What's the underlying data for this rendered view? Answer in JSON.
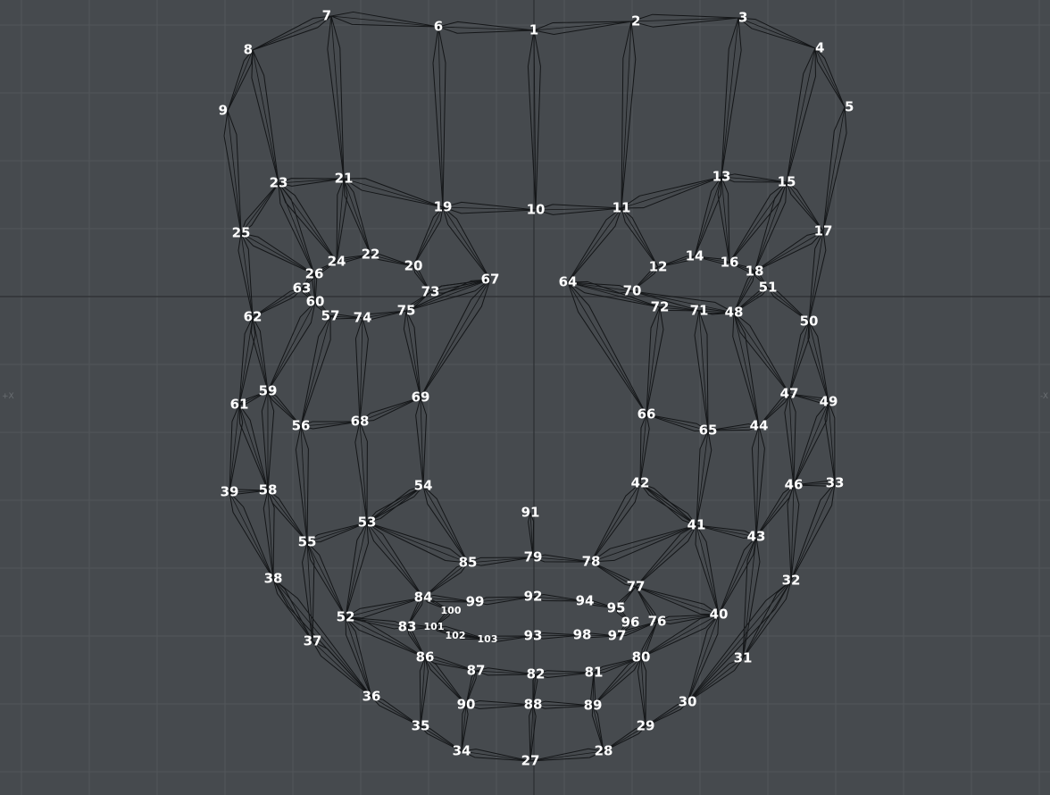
{
  "colors": {
    "background": "#464a4e",
    "grid": "#52565a",
    "axis": "#2c2f32",
    "wire": "#141618",
    "label": "#ffffff"
  },
  "viewport_edge_markers": [
    "+X",
    "-X"
  ],
  "mesh": {
    "vertices": [
      {
        "id": "1",
        "label": "1"
      },
      {
        "id": "2",
        "label": "2"
      },
      {
        "id": "3",
        "label": "3"
      },
      {
        "id": "4",
        "label": "4"
      },
      {
        "id": "5",
        "label": "5"
      },
      {
        "id": "6",
        "label": "6"
      },
      {
        "id": "7",
        "label": "7"
      },
      {
        "id": "8",
        "label": "8"
      },
      {
        "id": "9",
        "label": "9"
      },
      {
        "id": "10",
        "label": "10"
      },
      {
        "id": "11",
        "label": "11"
      },
      {
        "id": "12",
        "label": "12"
      },
      {
        "id": "13",
        "label": "13"
      },
      {
        "id": "14",
        "label": "14"
      },
      {
        "id": "15",
        "label": "15"
      },
      {
        "id": "16",
        "label": "16"
      },
      {
        "id": "17",
        "label": "17"
      },
      {
        "id": "18",
        "label": "18"
      },
      {
        "id": "19",
        "label": "19"
      },
      {
        "id": "20",
        "label": "20"
      },
      {
        "id": "21",
        "label": "21"
      },
      {
        "id": "22",
        "label": "22"
      },
      {
        "id": "23",
        "label": "23"
      },
      {
        "id": "24",
        "label": "24"
      },
      {
        "id": "25",
        "label": "25"
      },
      {
        "id": "26",
        "label": "26"
      },
      {
        "id": "27",
        "label": "27"
      },
      {
        "id": "28",
        "label": "28"
      },
      {
        "id": "29",
        "label": "29"
      },
      {
        "id": "30",
        "label": "30"
      },
      {
        "id": "31",
        "label": "31"
      },
      {
        "id": "32",
        "label": "32"
      },
      {
        "id": "33",
        "label": "33"
      },
      {
        "id": "34",
        "label": "34"
      },
      {
        "id": "35",
        "label": "35"
      },
      {
        "id": "36",
        "label": "36"
      },
      {
        "id": "37",
        "label": "37"
      },
      {
        "id": "38",
        "label": "38"
      },
      {
        "id": "39",
        "label": "39"
      },
      {
        "id": "40",
        "label": "40"
      },
      {
        "id": "41",
        "label": "41"
      },
      {
        "id": "42",
        "label": "42"
      },
      {
        "id": "43",
        "label": "43"
      },
      {
        "id": "44",
        "label": "44"
      },
      {
        "id": "46",
        "label": "46"
      },
      {
        "id": "47",
        "label": "47"
      },
      {
        "id": "48",
        "label": "48"
      },
      {
        "id": "49",
        "label": "49"
      },
      {
        "id": "50",
        "label": "50"
      },
      {
        "id": "51",
        "label": "51"
      },
      {
        "id": "52",
        "label": "52"
      },
      {
        "id": "53",
        "label": "53"
      },
      {
        "id": "54",
        "label": "54"
      },
      {
        "id": "55",
        "label": "55"
      },
      {
        "id": "56",
        "label": "56"
      },
      {
        "id": "57",
        "label": "57"
      },
      {
        "id": "58",
        "label": "58"
      },
      {
        "id": "59",
        "label": "59"
      },
      {
        "id": "60",
        "label": "60"
      },
      {
        "id": "61",
        "label": "61"
      },
      {
        "id": "62",
        "label": "62"
      },
      {
        "id": "63",
        "label": "63"
      },
      {
        "id": "64",
        "label": "64"
      },
      {
        "id": "65",
        "label": "65"
      },
      {
        "id": "66",
        "label": "66"
      },
      {
        "id": "67",
        "label": "67"
      },
      {
        "id": "68",
        "label": "68"
      },
      {
        "id": "69",
        "label": "69"
      },
      {
        "id": "70",
        "label": "70"
      },
      {
        "id": "71",
        "label": "71"
      },
      {
        "id": "72",
        "label": "72"
      },
      {
        "id": "73",
        "label": "73"
      },
      {
        "id": "74",
        "label": "74"
      },
      {
        "id": "75",
        "label": "75"
      },
      {
        "id": "76",
        "label": "76"
      },
      {
        "id": "77",
        "label": "77"
      },
      {
        "id": "78",
        "label": "78"
      },
      {
        "id": "79",
        "label": "79"
      },
      {
        "id": "80",
        "label": "80"
      },
      {
        "id": "81",
        "label": "81"
      },
      {
        "id": "82",
        "label": "82"
      },
      {
        "id": "83",
        "label": "83"
      },
      {
        "id": "84",
        "label": "84"
      },
      {
        "id": "85",
        "label": "85"
      },
      {
        "id": "86",
        "label": "86"
      },
      {
        "id": "87",
        "label": "87"
      },
      {
        "id": "88",
        "label": "88"
      },
      {
        "id": "89",
        "label": "89"
      },
      {
        "id": "90",
        "label": "90"
      },
      {
        "id": "91",
        "label": "91"
      },
      {
        "id": "92",
        "label": "92"
      },
      {
        "id": "93",
        "label": "93"
      },
      {
        "id": "94",
        "label": "94"
      },
      {
        "id": "95",
        "label": "95"
      },
      {
        "id": "96",
        "label": "96"
      },
      {
        "id": "97",
        "label": "97"
      },
      {
        "id": "98",
        "label": "98"
      },
      {
        "id": "99",
        "label": "99"
      },
      {
        "id": "100",
        "label": "100"
      },
      {
        "id": "101",
        "label": "101"
      },
      {
        "id": "102",
        "label": "102"
      },
      {
        "id": "103",
        "label": "103"
      }
    ],
    "edges": [
      [
        "7",
        "6"
      ],
      [
        "6",
        "1"
      ],
      [
        "1",
        "2"
      ],
      [
        "2",
        "3"
      ],
      [
        "7",
        "8"
      ],
      [
        "8",
        "9"
      ],
      [
        "3",
        "4"
      ],
      [
        "4",
        "5"
      ],
      [
        "1",
        "10"
      ],
      [
        "6",
        "19"
      ],
      [
        "2",
        "11"
      ],
      [
        "7",
        "21"
      ],
      [
        "3",
        "13"
      ],
      [
        "8",
        "23"
      ],
      [
        "4",
        "15"
      ],
      [
        "9",
        "25"
      ],
      [
        "5",
        "17"
      ],
      [
        "25",
        "23"
      ],
      [
        "23",
        "21"
      ],
      [
        "21",
        "19"
      ],
      [
        "19",
        "10"
      ],
      [
        "10",
        "11"
      ],
      [
        "11",
        "13"
      ],
      [
        "13",
        "15"
      ],
      [
        "15",
        "17"
      ],
      [
        "25",
        "26"
      ],
      [
        "23",
        "26"
      ],
      [
        "23",
        "24"
      ],
      [
        "21",
        "24"
      ],
      [
        "21",
        "22"
      ],
      [
        "19",
        "20"
      ],
      [
        "19",
        "67"
      ],
      [
        "26",
        "24"
      ],
      [
        "24",
        "22"
      ],
      [
        "22",
        "20"
      ],
      [
        "20",
        "73"
      ],
      [
        "73",
        "67"
      ],
      [
        "17",
        "18"
      ],
      [
        "15",
        "18"
      ],
      [
        "15",
        "16"
      ],
      [
        "13",
        "16"
      ],
      [
        "13",
        "14"
      ],
      [
        "11",
        "12"
      ],
      [
        "11",
        "64"
      ],
      [
        "18",
        "16"
      ],
      [
        "16",
        "14"
      ],
      [
        "14",
        "12"
      ],
      [
        "12",
        "70"
      ],
      [
        "70",
        "64"
      ],
      [
        "25",
        "62"
      ],
      [
        "26",
        "63"
      ],
      [
        "63",
        "60"
      ],
      [
        "63",
        "62"
      ],
      [
        "26",
        "60"
      ],
      [
        "17",
        "50"
      ],
      [
        "18",
        "51"
      ],
      [
        "51",
        "48"
      ],
      [
        "51",
        "50"
      ],
      [
        "18",
        "48"
      ],
      [
        "60",
        "57"
      ],
      [
        "57",
        "74"
      ],
      [
        "74",
        "75"
      ],
      [
        "75",
        "73"
      ],
      [
        "73",
        "67"
      ],
      [
        "67",
        "75"
      ],
      [
        "64",
        "72"
      ],
      [
        "72",
        "71"
      ],
      [
        "71",
        "48"
      ],
      [
        "48",
        "70"
      ],
      [
        "62",
        "61"
      ],
      [
        "62",
        "59"
      ],
      [
        "60",
        "59"
      ],
      [
        "57",
        "56"
      ],
      [
        "74",
        "68"
      ],
      [
        "75",
        "69"
      ],
      [
        "67",
        "69"
      ],
      [
        "50",
        "49"
      ],
      [
        "50",
        "47"
      ],
      [
        "48",
        "47"
      ],
      [
        "48",
        "44"
      ],
      [
        "71",
        "65"
      ],
      [
        "72",
        "66"
      ],
      [
        "64",
        "66"
      ],
      [
        "61",
        "59"
      ],
      [
        "59",
        "56"
      ],
      [
        "56",
        "68"
      ],
      [
        "68",
        "69"
      ],
      [
        "49",
        "47"
      ],
      [
        "47",
        "44"
      ],
      [
        "44",
        "65"
      ],
      [
        "65",
        "66"
      ],
      [
        "61",
        "39"
      ],
      [
        "61",
        "58"
      ],
      [
        "59",
        "58"
      ],
      [
        "56",
        "55"
      ],
      [
        "68",
        "53"
      ],
      [
        "69",
        "54"
      ],
      [
        "49",
        "33"
      ],
      [
        "49",
        "46"
      ],
      [
        "47",
        "46"
      ],
      [
        "44",
        "43"
      ],
      [
        "65",
        "41"
      ],
      [
        "66",
        "42"
      ],
      [
        "39",
        "58"
      ],
      [
        "58",
        "55"
      ],
      [
        "55",
        "53"
      ],
      [
        "53",
        "54"
      ],
      [
        "33",
        "46"
      ],
      [
        "46",
        "43"
      ],
      [
        "43",
        "41"
      ],
      [
        "41",
        "42"
      ],
      [
        "39",
        "38"
      ],
      [
        "58",
        "38"
      ],
      [
        "55",
        "37"
      ],
      [
        "55",
        "52"
      ],
      [
        "53",
        "52"
      ],
      [
        "53",
        "84"
      ],
      [
        "54",
        "85"
      ],
      [
        "54",
        "53"
      ],
      [
        "33",
        "32"
      ],
      [
        "46",
        "32"
      ],
      [
        "43",
        "31"
      ],
      [
        "43",
        "40"
      ],
      [
        "41",
        "40"
      ],
      [
        "41",
        "77"
      ],
      [
        "42",
        "78"
      ],
      [
        "42",
        "41"
      ],
      [
        "38",
        "37"
      ],
      [
        "37",
        "36"
      ],
      [
        "36",
        "35"
      ],
      [
        "35",
        "34"
      ],
      [
        "34",
        "27"
      ],
      [
        "32",
        "31"
      ],
      [
        "31",
        "30"
      ],
      [
        "30",
        "29"
      ],
      [
        "29",
        "28"
      ],
      [
        "28",
        "27"
      ],
      [
        "38",
        "36"
      ],
      [
        "52",
        "36"
      ],
      [
        "52",
        "86"
      ],
      [
        "86",
        "35"
      ],
      [
        "86",
        "90"
      ],
      [
        "90",
        "34"
      ],
      [
        "32",
        "30"
      ],
      [
        "40",
        "30"
      ],
      [
        "40",
        "80"
      ],
      [
        "80",
        "29"
      ],
      [
        "80",
        "89"
      ],
      [
        "89",
        "28"
      ],
      [
        "91",
        "79"
      ],
      [
        "85",
        "79"
      ],
      [
        "79",
        "78"
      ],
      [
        "85",
        "84"
      ],
      [
        "84",
        "83"
      ],
      [
        "83",
        "86"
      ],
      [
        "86",
        "87"
      ],
      [
        "87",
        "82"
      ],
      [
        "82",
        "81"
      ],
      [
        "81",
        "80"
      ],
      [
        "80",
        "76"
      ],
      [
        "76",
        "77"
      ],
      [
        "77",
        "78"
      ],
      [
        "84",
        "99"
      ],
      [
        "99",
        "92"
      ],
      [
        "92",
        "94"
      ],
      [
        "94",
        "95"
      ],
      [
        "95",
        "77"
      ],
      [
        "83",
        "101"
      ],
      [
        "101",
        "103"
      ],
      [
        "103",
        "93"
      ],
      [
        "93",
        "98"
      ],
      [
        "98",
        "97"
      ],
      [
        "97",
        "76"
      ],
      [
        "84",
        "100"
      ],
      [
        "100",
        "101"
      ],
      [
        "101",
        "102"
      ],
      [
        "102",
        "103"
      ],
      [
        "95",
        "96"
      ],
      [
        "96",
        "97"
      ],
      [
        "83",
        "52"
      ],
      [
        "76",
        "40"
      ],
      [
        "87",
        "90"
      ],
      [
        "90",
        "88"
      ],
      [
        "88",
        "89"
      ],
      [
        "89",
        "81"
      ],
      [
        "82",
        "88"
      ],
      [
        "88",
        "27"
      ],
      [
        "85",
        "53"
      ],
      [
        "78",
        "41"
      ],
      [
        "52",
        "84"
      ],
      [
        "40",
        "77"
      ]
    ]
  }
}
